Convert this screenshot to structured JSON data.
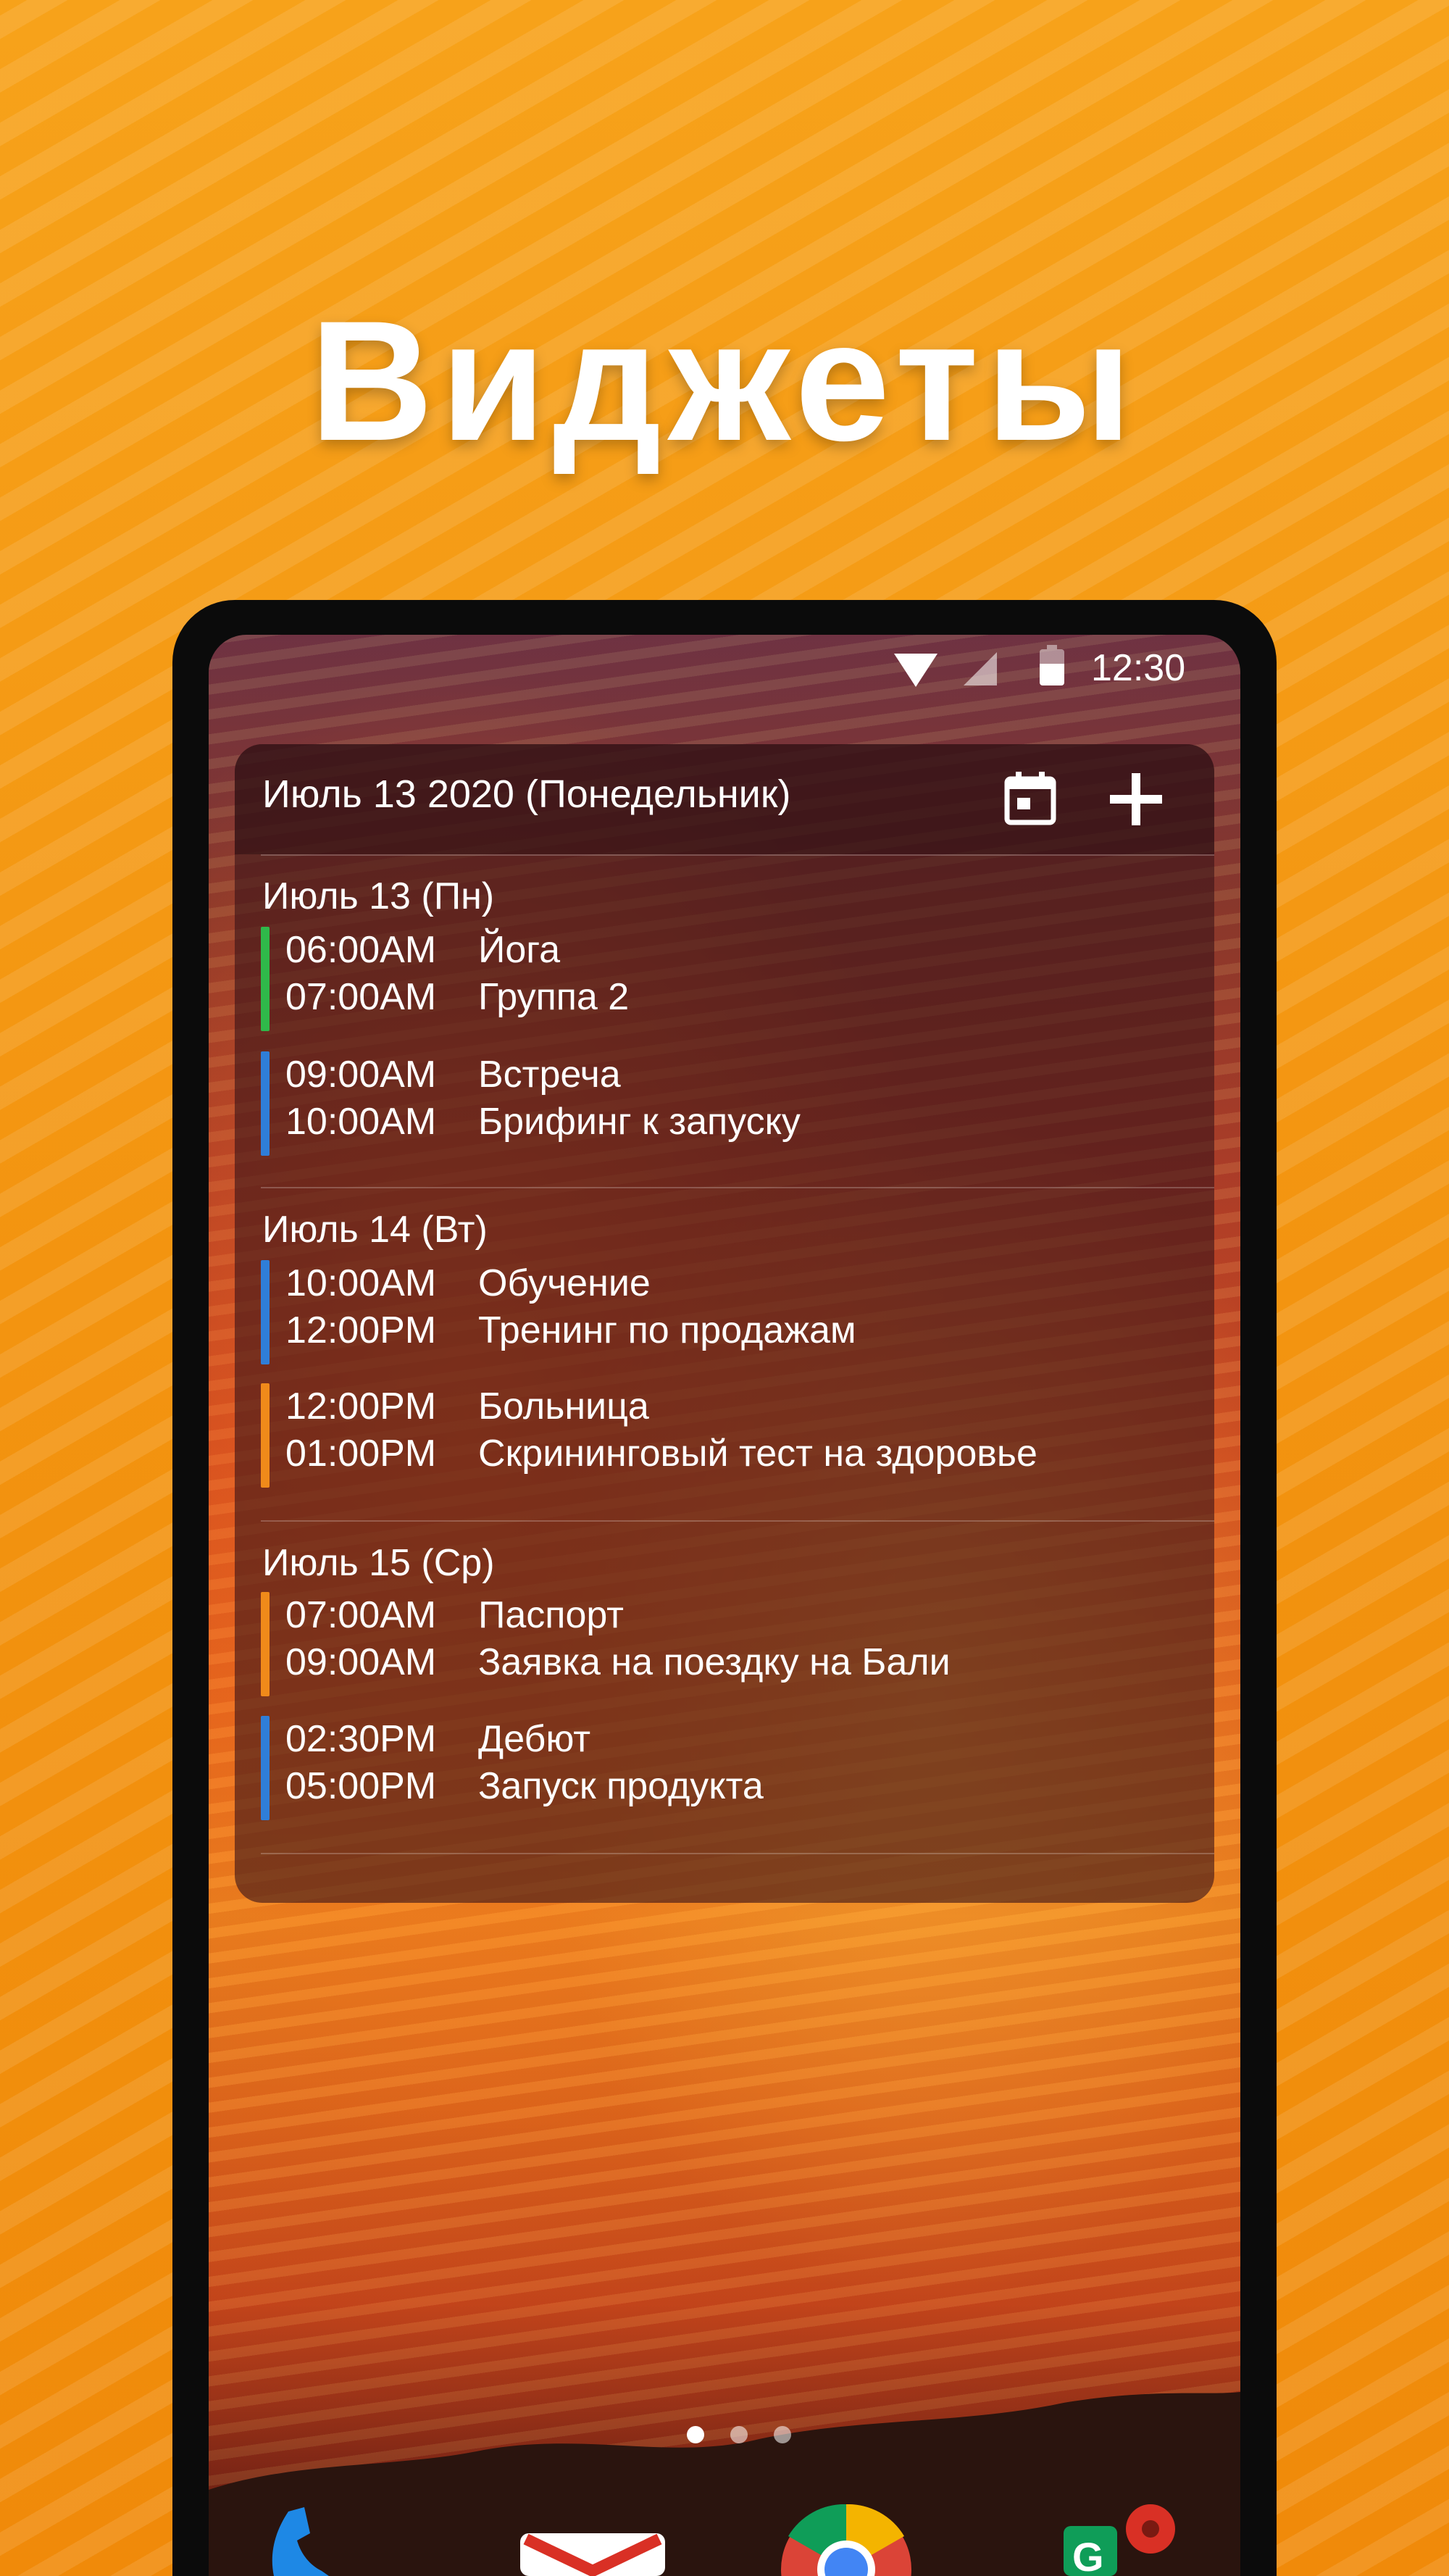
{
  "headline": "Виджеты",
  "status_bar": {
    "time": "12:30",
    "icons": [
      "wifi-icon",
      "signal-icon",
      "battery-icon"
    ]
  },
  "widget": {
    "date_title": "Июль 13 2020 (Понедельник)",
    "actions": [
      "calendar-icon",
      "plus-icon"
    ],
    "days": [
      {
        "label": "Июль 13 (Пн)",
        "events": [
          {
            "start": "06:00AM",
            "end": "07:00AM",
            "title": "Йога",
            "subtitle": "Группа 2",
            "color": "#2fb94a"
          },
          {
            "start": "09:00AM",
            "end": "10:00AM",
            "title": "Встреча",
            "subtitle": "Брифинг к запуску",
            "color": "#2f7ed8"
          }
        ]
      },
      {
        "label": "Июль 14 (Вт)",
        "events": [
          {
            "start": "10:00AM",
            "end": "12:00PM",
            "title": "Обучение",
            "subtitle": "Тренинг по продажам",
            "color": "#2f7ed8"
          },
          {
            "start": "12:00PM",
            "end": "01:00PM",
            "title": "Больница",
            "subtitle": "Скрининговый тест на здоровье",
            "color": "#f08a1a"
          }
        ]
      },
      {
        "label": "Июль 15 (Ср)",
        "events": [
          {
            "start": "07:00AM",
            "end": "09:00AM",
            "title": "Паспорт",
            "subtitle": "Заявка на поездку на Бали",
            "color": "#f08a1a"
          },
          {
            "start": "02:30PM",
            "end": "05:00PM",
            "title": "Дебют",
            "subtitle": "Запуск продукта",
            "color": "#2f7ed8"
          }
        ]
      }
    ]
  },
  "home_screen": {
    "page_indicator": {
      "pages": 3,
      "active": 1
    },
    "dock_apps": [
      "phone-icon",
      "gmail-icon",
      "chrome-icon",
      "maps-icon"
    ]
  },
  "colors": {
    "background": "#f39410",
    "widget_bg": "#3a1418",
    "accent_green": "#2fb94a",
    "accent_blue": "#2f7ed8",
    "accent_orange": "#f08a1a"
  }
}
